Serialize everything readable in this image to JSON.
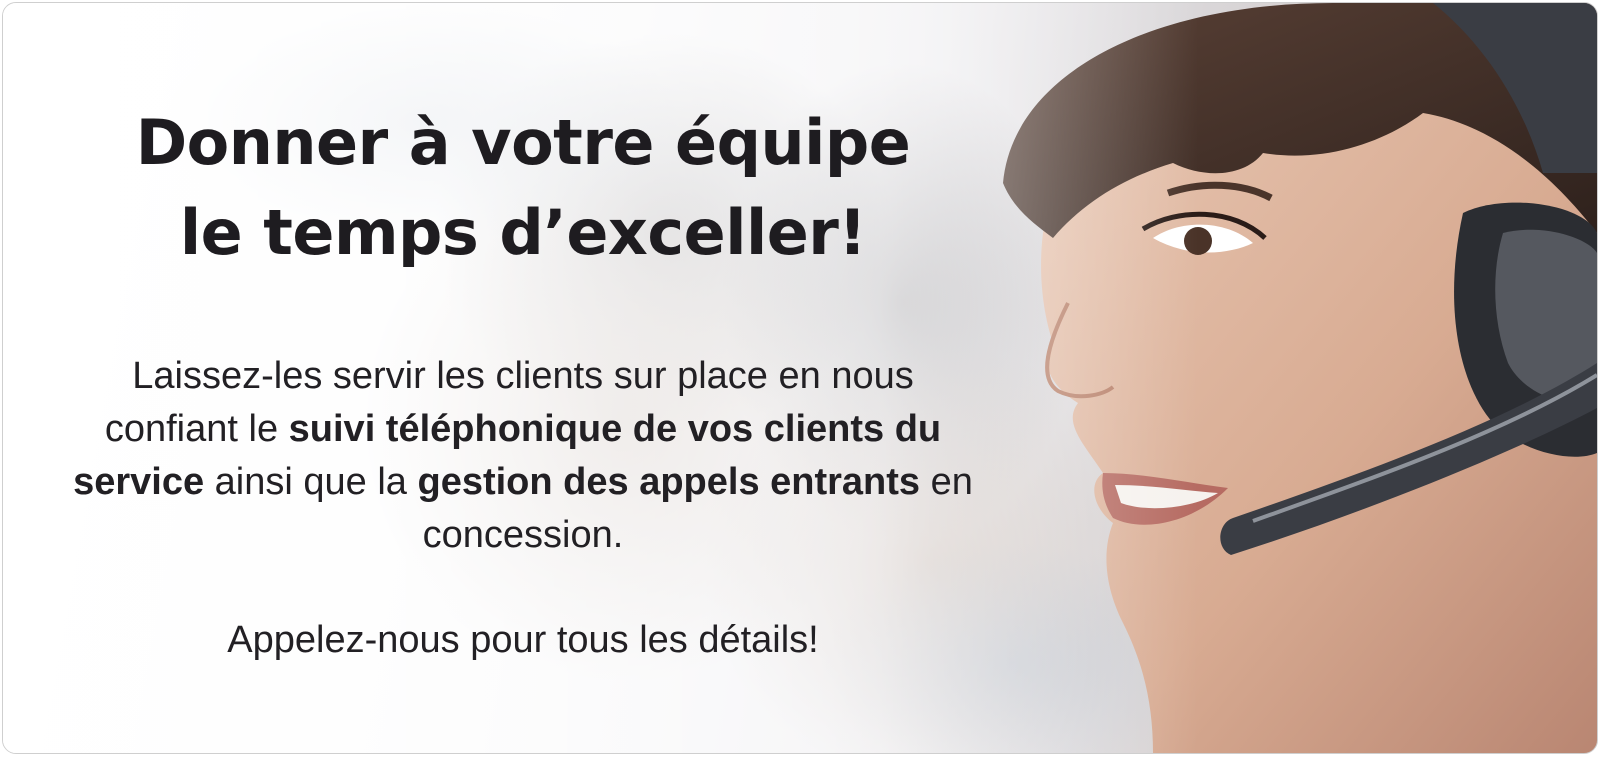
{
  "banner": {
    "headline": {
      "line1": "Donner à votre équipe",
      "line2": "le temps d’exceller!"
    },
    "body": {
      "part1": "Laissez-les servir les clients sur place en nous confiant le ",
      "bold1": "suivi téléphonique de vos clients du service",
      "part2": " ainsi que la ",
      "bold2": "gestion des appels entrants",
      "part3": " en concession."
    },
    "cta": "Appelez-nous pour tous les détails!",
    "photo": "call-center-agent-with-headset",
    "colors": {
      "text": "#222024",
      "headset": "#3a3d44"
    }
  }
}
